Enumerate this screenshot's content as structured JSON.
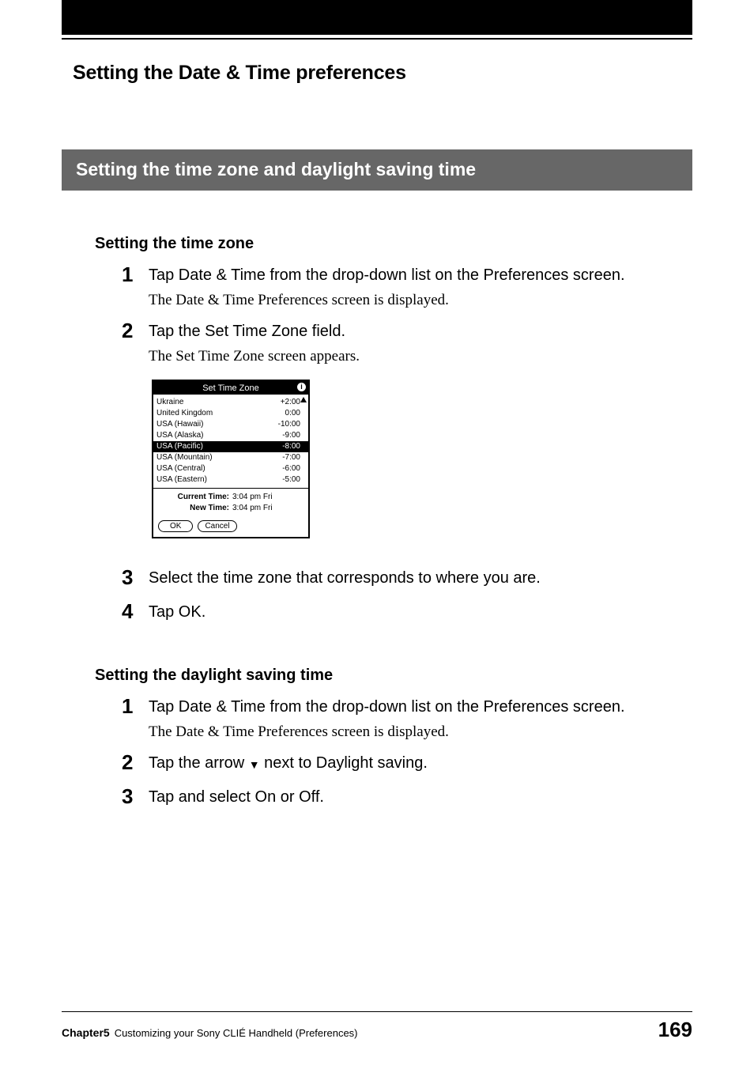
{
  "chapterHeading": "Setting the Date & Time preferences",
  "sectionBar": "Setting the time zone and daylight saving time",
  "tz": {
    "heading": "Setting the time zone",
    "steps": [
      {
        "main": "Tap Date & Time from the drop-down list on the Preferences screen.",
        "sub": "The Date & Time Preferences screen is displayed."
      },
      {
        "main": "Tap the Set Time Zone field.",
        "sub": "The Set Time Zone screen appears."
      },
      {
        "main": "Select the time zone that corresponds to where you are."
      },
      {
        "main": "Tap OK."
      }
    ]
  },
  "pda": {
    "title": "Set Time Zone",
    "rows": [
      {
        "name": "Ukraine",
        "offset": "+2:00"
      },
      {
        "name": "United Kingdom",
        "offset": "0:00"
      },
      {
        "name": "USA (Hawaii)",
        "offset": "-10:00"
      },
      {
        "name": "USA (Alaska)",
        "offset": "-9:00"
      },
      {
        "name": "USA (Pacific)",
        "offset": "-8:00",
        "selected": true
      },
      {
        "name": "USA (Mountain)",
        "offset": "-7:00"
      },
      {
        "name": "USA (Central)",
        "offset": "-6:00"
      },
      {
        "name": "USA (Eastern)",
        "offset": "-5:00"
      }
    ],
    "currentLbl": "Current Time:",
    "currentVal": "3:04 pm Fri",
    "newLbl": "New Time:",
    "newVal": "3:04 pm Fri",
    "ok": "OK",
    "cancel": "Cancel"
  },
  "dst": {
    "heading": "Setting the daylight saving time",
    "steps": [
      {
        "main": "Tap Date & Time from the drop-down list on the Preferences screen.",
        "sub": "The Date & Time Preferences screen is displayed."
      },
      {
        "mainPre": "Tap the arrow ",
        "arrow": "▼",
        "mainPost": " next to Daylight saving."
      },
      {
        "main": "Tap and select On or Off."
      }
    ]
  },
  "footer": {
    "chapter": "Chapter5",
    "text": "Customizing your Sony CLIÉ Handheld (Preferences)",
    "page": "169"
  }
}
